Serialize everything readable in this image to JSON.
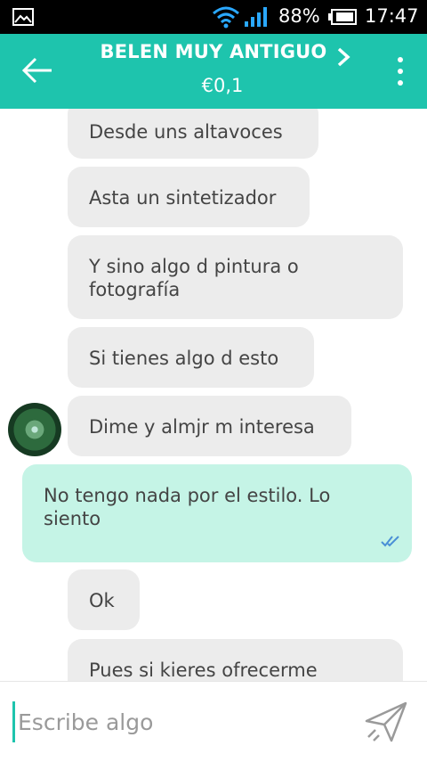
{
  "status_bar": {
    "battery_percent": "88%",
    "time": "17:47",
    "icons": [
      "gallery-icon",
      "wifi-icon",
      "signal-icon",
      "battery-icon"
    ]
  },
  "header": {
    "title": "BELEN MUY ANTIGUO",
    "price": "€0,1",
    "icons": [
      "back-arrow-icon",
      "chevron-right-icon",
      "more-vert-icon"
    ]
  },
  "messages": [
    {
      "side": "received",
      "text": "Desde uns altavoces"
    },
    {
      "side": "received",
      "text": "Asta un sintetizador"
    },
    {
      "side": "received",
      "text": "Y sino algo d pintura o fotografía"
    },
    {
      "side": "received",
      "text": "Si tienes algo d esto"
    },
    {
      "side": "received",
      "text": "Dime y almjr m interesa"
    },
    {
      "side": "sent",
      "text": "No tengo nada por el estilo. Lo siento"
    },
    {
      "side": "received",
      "text": "Ok"
    },
    {
      "side": "received",
      "text": "Pues si kieres ofrecerme"
    }
  ],
  "composer": {
    "placeholder": "Escribe algo"
  },
  "colors": {
    "accent": "#1ec4ad",
    "received_bubble": "#ececec",
    "sent_bubble": "#c5f4e6",
    "read_ticks": "#4a8fd6"
  }
}
